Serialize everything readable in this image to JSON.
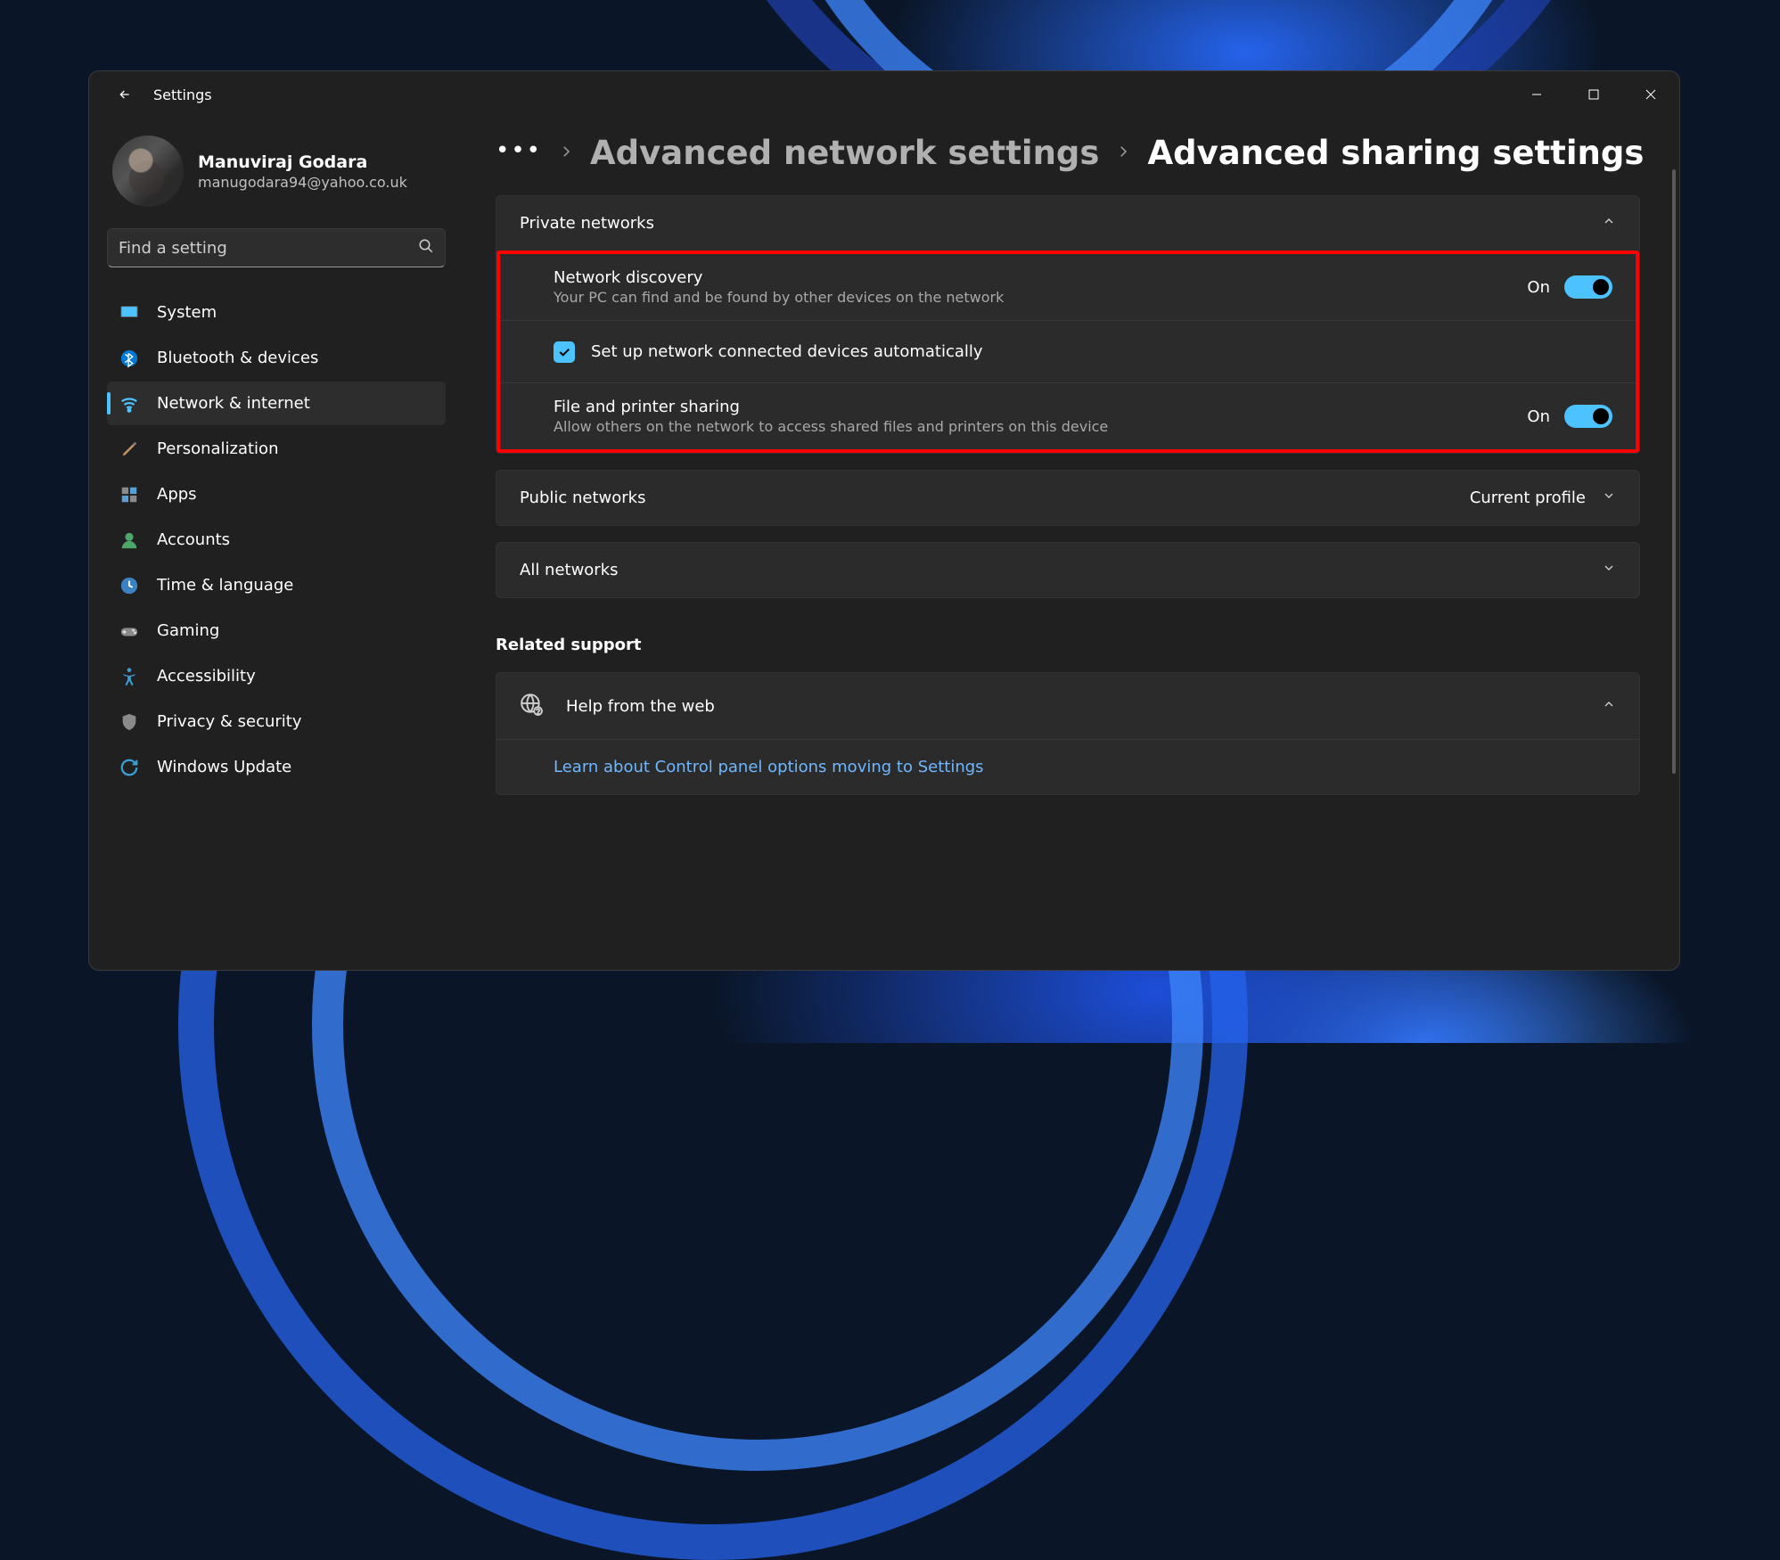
{
  "app": {
    "title": "Settings"
  },
  "user": {
    "name": "Manuviraj Godara",
    "email": "manugodara94@yahoo.co.uk"
  },
  "search": {
    "placeholder": "Find a setting"
  },
  "nav": {
    "system": "System",
    "bluetooth": "Bluetooth & devices",
    "network": "Network & internet",
    "personalization": "Personalization",
    "apps": "Apps",
    "accounts": "Accounts",
    "time": "Time & language",
    "gaming": "Gaming",
    "accessibility": "Accessibility",
    "privacy": "Privacy & security",
    "update": "Windows Update"
  },
  "breadcrumb": {
    "parent": "Advanced network settings",
    "current": "Advanced sharing settings"
  },
  "private_section": {
    "header": "Private networks",
    "network_discovery": {
      "title": "Network discovery",
      "sub": "Your PC can find and be found by other devices on the network",
      "state": "On"
    },
    "auto_setup": {
      "label": "Set up network connected devices automatically"
    },
    "file_sharing": {
      "title": "File and printer sharing",
      "sub": "Allow others on the network to access shared files and printers on this device",
      "state": "On"
    }
  },
  "public_section": {
    "header": "Public networks",
    "badge": "Current profile"
  },
  "all_section": {
    "header": "All networks"
  },
  "related": {
    "heading": "Related support",
    "help_title": "Help from the web",
    "link1": "Learn about Control panel options moving to Settings"
  }
}
